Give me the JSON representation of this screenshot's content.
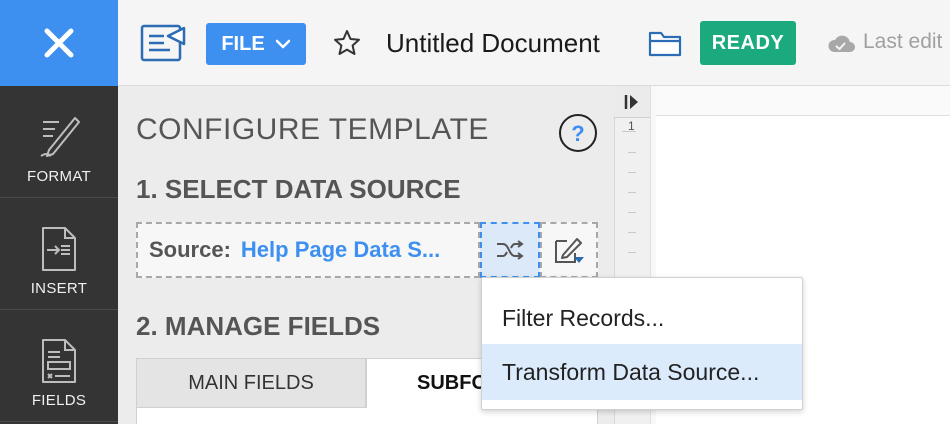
{
  "header": {
    "file_label": "FILE",
    "doc_title": "Untitled Document",
    "status_badge": "READY",
    "last_edit_text": "Last edit"
  },
  "nav": {
    "items": [
      {
        "label": "FORMAT",
        "icon": "pen-icon"
      },
      {
        "label": "INSERT",
        "icon": "insert-doc-icon"
      },
      {
        "label": "FIELDS",
        "icon": "fields-doc-icon"
      }
    ]
  },
  "panel": {
    "title": "CONFIGURE TEMPLATE",
    "help_symbol": "?",
    "section1_title": "1. SELECT DATA SOURCE",
    "source_label": "Source:",
    "source_value": "Help Page Data S...",
    "section2_title": "2. MANAGE FIELDS",
    "tabs": [
      {
        "label": "MAIN FIELDS"
      },
      {
        "label": "SUBFO"
      }
    ]
  },
  "ruler": {
    "first_mark": "1"
  },
  "menu": {
    "items": [
      {
        "label": "Filter Records..."
      },
      {
        "label": "Transform Data Source..."
      }
    ]
  },
  "colors": {
    "accent": "#3d8ff0",
    "ready": "#1aaa7e",
    "nav_bg": "#343434",
    "panel_bg": "#ececec",
    "menu_highlight": "#dcebfb"
  }
}
